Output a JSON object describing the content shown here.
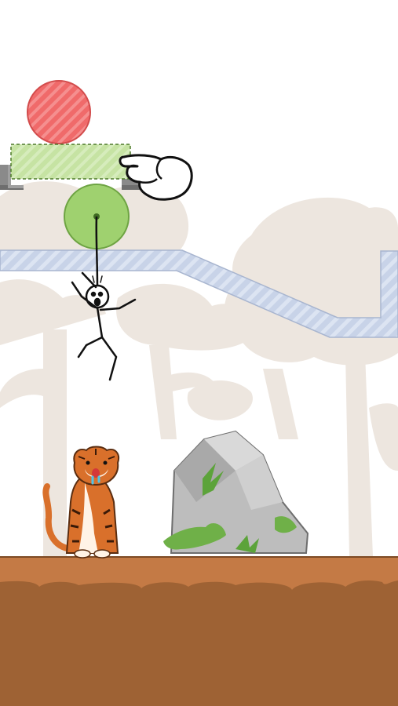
{
  "scene": {
    "type": "physics puzzle game",
    "ui_text": []
  },
  "colors": {
    "sky": "#ffffff",
    "background_trees": "#ede6df",
    "red_ball": "#f06a6a",
    "green_block": "#c6e3a3",
    "green_ball": "#9fd16f",
    "glass_platform": "#c8d3e8",
    "ground_top": "#c47a45",
    "ground": "#9e6234",
    "rock": "#bdbdbd",
    "tiger_orange": "#d9702b"
  },
  "objects": {
    "red_ball": {
      "pattern": "diagonal-stripes"
    },
    "green_removable_block": {
      "removable": true
    },
    "green_ball": {
      "attached": "rope"
    },
    "stickman": {
      "expression": "scared"
    },
    "tiger": {
      "state": "sitting, drooling"
    },
    "rock": {
      "moss": true
    },
    "tutorial_hand": {
      "gesture": "tap"
    }
  }
}
